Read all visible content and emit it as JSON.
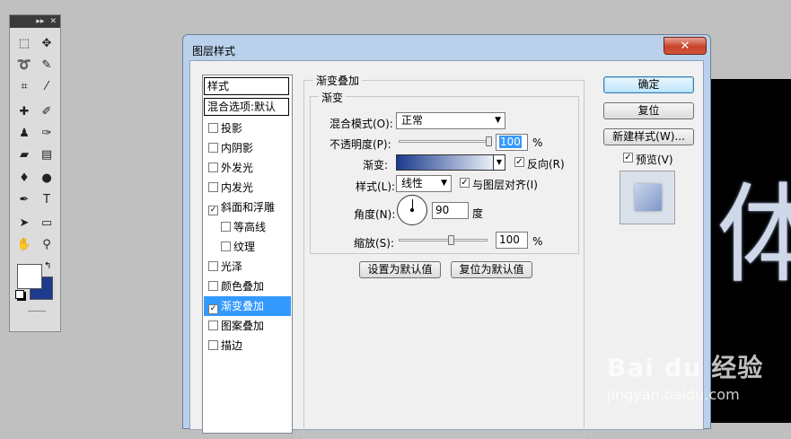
{
  "tools_palette": {
    "title_icons": [
      "▸▸",
      "✕"
    ],
    "tools": [
      {
        "icon": "marquee-icon",
        "glyph": "⬚"
      },
      {
        "icon": "move-icon",
        "glyph": "✥"
      },
      {
        "icon": "lasso-icon",
        "glyph": "➰"
      },
      {
        "icon": "magic-wand-icon",
        "glyph": "✎"
      },
      {
        "icon": "crop-icon",
        "glyph": "⌗"
      },
      {
        "icon": "eyedropper-icon",
        "glyph": "⁄"
      },
      {
        "icon": "healing-brush-icon",
        "glyph": "✚"
      },
      {
        "icon": "brush-icon",
        "glyph": "✐"
      },
      {
        "icon": "clone-stamp-icon",
        "glyph": "♟"
      },
      {
        "icon": "history-brush-icon",
        "glyph": "✑"
      },
      {
        "icon": "eraser-icon",
        "glyph": "▰"
      },
      {
        "icon": "gradient-icon",
        "glyph": "▤"
      },
      {
        "icon": "blur-icon",
        "glyph": "♦"
      },
      {
        "icon": "dodge-icon",
        "glyph": "●"
      },
      {
        "icon": "pen-icon",
        "glyph": "✒"
      },
      {
        "icon": "type-icon",
        "glyph": "T"
      },
      {
        "icon": "path-select-icon",
        "glyph": "➤"
      },
      {
        "icon": "shape-icon",
        "glyph": "▭"
      },
      {
        "icon": "hand-icon",
        "glyph": "✋"
      },
      {
        "icon": "zoom-icon",
        "glyph": "⚲"
      }
    ],
    "foreground_color": "#ffffff",
    "background_color": "#1e3c8e",
    "swap_glyph": "↰"
  },
  "canvas": {
    "glyph": "体"
  },
  "dialog": {
    "title": "图层样式",
    "close_glyph": "✕",
    "styles_header": "样式",
    "blend_options": "混合选项:默认",
    "style_items": [
      {
        "label": "投影",
        "checked": false,
        "indent": false,
        "selected": false
      },
      {
        "label": "内阴影",
        "checked": false,
        "indent": false,
        "selected": false
      },
      {
        "label": "外发光",
        "checked": false,
        "indent": false,
        "selected": false
      },
      {
        "label": "内发光",
        "checked": false,
        "indent": false,
        "selected": false
      },
      {
        "label": "斜面和浮雕",
        "checked": true,
        "indent": false,
        "selected": false
      },
      {
        "label": "等高线",
        "checked": false,
        "indent": true,
        "selected": false
      },
      {
        "label": "纹理",
        "checked": false,
        "indent": true,
        "selected": false
      },
      {
        "label": "光泽",
        "checked": false,
        "indent": false,
        "selected": false
      },
      {
        "label": "颜色叠加",
        "checked": false,
        "indent": false,
        "selected": false
      },
      {
        "label": "渐变叠加",
        "checked": true,
        "indent": false,
        "selected": true
      },
      {
        "label": "图案叠加",
        "checked": false,
        "indent": false,
        "selected": false
      },
      {
        "label": "描边",
        "checked": false,
        "indent": false,
        "selected": false
      }
    ],
    "gradient_overlay": {
      "section_title": "渐变叠加",
      "group_title": "渐变",
      "blend_mode_label": "混合模式(O):",
      "blend_mode_value": "正常",
      "opacity_label": "不透明度(P):",
      "opacity_value": "100",
      "opacity_unit": "%",
      "opacity_level": 1.0,
      "gradient_label": "渐变:",
      "reverse_label": "反向(R)",
      "reverse_checked": true,
      "style_label": "样式(L):",
      "style_value": "线性",
      "align_label": "与图层对齐(I)",
      "align_checked": true,
      "angle_label": "角度(N):",
      "angle_value": "90",
      "angle_unit": "度",
      "scale_label": "缩放(S):",
      "scale_value": "100",
      "scale_unit": "%",
      "scale_level": 0.6,
      "make_default": "设置为默认值",
      "reset_default": "复位为默认值",
      "gradient_start": "#1a3a8c",
      "gradient_end": "#eaf0f8"
    },
    "buttons": {
      "ok": "确定",
      "reset": "复位",
      "new_style": "新建样式(W)...",
      "preview_label": "预览(V)",
      "preview_checked": true
    }
  },
  "watermark": {
    "logo": "Bai du 经验",
    "url": "jingyan.baidu.com"
  }
}
